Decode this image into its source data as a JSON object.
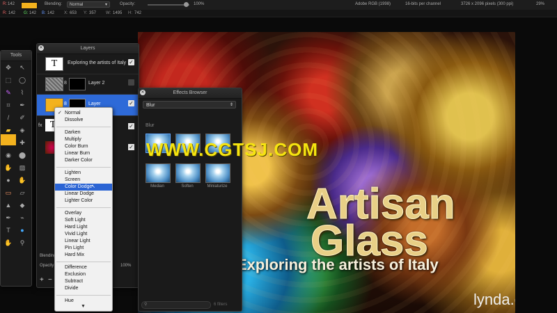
{
  "topbar": {
    "r_label": "R:",
    "r_value": "142",
    "g_label": "G:",
    "g_value": "142",
    "b_label": "B:",
    "b_value": "142",
    "x_label": "X:",
    "x_value": "653",
    "y_label": "Y:",
    "y_value": "357",
    "w_label": "W:",
    "w_value": "1495",
    "h_label": "H:",
    "h_value": "742",
    "blending_label": "Blending:",
    "blending_value": "Normal",
    "opacity_label": "Opacity:",
    "opacity_value": "100%",
    "color_profile": "Adobe RGB (1998)",
    "bit_depth": "16-bits per channel",
    "image_size": "3726 x 2096 pixels (300 ppi)",
    "zoom": "29%",
    "swatch_color": "#f3b21e"
  },
  "tools": {
    "title": "Tools"
  },
  "layers": {
    "title": "Layers",
    "rows": [
      {
        "name": "Exploring the artists of Italy",
        "kind": "text"
      },
      {
        "name": "Layer 2",
        "kind": "image"
      },
      {
        "name": "Layer",
        "kind": "image"
      }
    ],
    "blending_label": "Blending",
    "opacity_label": "Opacity",
    "opacity_value": "100%",
    "fx_label": "fx",
    "row_number_1": "8",
    "row_number_2": "8"
  },
  "blend_menu": {
    "selected": "Color Dodge",
    "groups": [
      [
        "Normal",
        "Dissolve"
      ],
      [
        "Darken",
        "Multiply",
        "Color Burn",
        "Linear Burn",
        "Darker Color"
      ],
      [
        "Lighten",
        "Screen",
        "Color Dodge",
        "Linear Dodge",
        "Lighter Color"
      ],
      [
        "Overlay",
        "Soft Light",
        "Hard Light",
        "Vivid Light",
        "Linear Light",
        "Pin Light",
        "Hard Mix"
      ],
      [
        "Difference",
        "Exclusion",
        "Subtract",
        "Divide"
      ],
      [
        "Hue"
      ]
    ]
  },
  "effects_browser": {
    "title": "Effects Browser",
    "category": "Blur",
    "section": "Blur",
    "filters": [
      "Median",
      "Soften",
      "Miniaturize"
    ],
    "count": "6 filters"
  },
  "canvas": {
    "title_line1": "Artisan",
    "title_line2": "Glass",
    "subtitle": "Exploring the artists of Italy",
    "watermark": "WWW.CGTSJ.COM",
    "brand": "lynda.com"
  }
}
